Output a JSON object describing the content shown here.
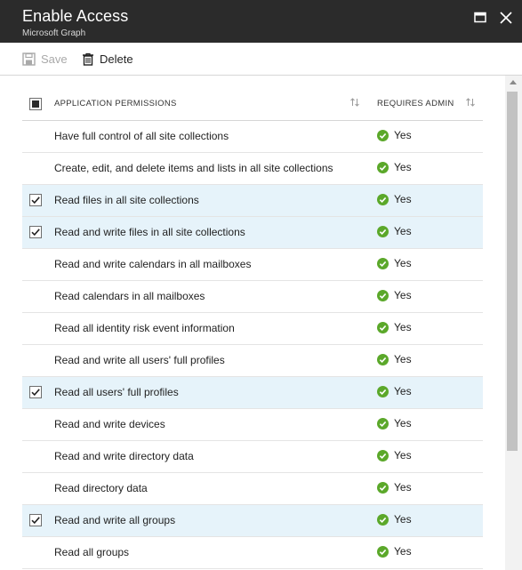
{
  "blade": {
    "title": "Enable Access",
    "subtitle": "Microsoft Graph"
  },
  "toolbar": {
    "save_label": "Save",
    "delete_label": "Delete"
  },
  "table": {
    "headers": {
      "permission": "APPLICATION PERMISSIONS",
      "requires_admin": "REQUIRES ADMIN"
    },
    "rows": [
      {
        "label": "Have full control of all site collections",
        "admin": "Yes",
        "checked": false
      },
      {
        "label": "Create, edit, and delete items and lists in all site collections",
        "admin": "Yes",
        "checked": false
      },
      {
        "label": "Read files in all site collections",
        "admin": "Yes",
        "checked": true
      },
      {
        "label": "Read and write files in all site collections",
        "admin": "Yes",
        "checked": true
      },
      {
        "label": "Read and write calendars in all mailboxes",
        "admin": "Yes",
        "checked": false
      },
      {
        "label": "Read calendars in all mailboxes",
        "admin": "Yes",
        "checked": false
      },
      {
        "label": "Read all identity risk event information",
        "admin": "Yes",
        "checked": false
      },
      {
        "label": "Read and write all users' full profiles",
        "admin": "Yes",
        "checked": false
      },
      {
        "label": "Read all users' full profiles",
        "admin": "Yes",
        "checked": true
      },
      {
        "label": "Read and write devices",
        "admin": "Yes",
        "checked": false
      },
      {
        "label": "Read and write directory data",
        "admin": "Yes",
        "checked": false
      },
      {
        "label": "Read directory data",
        "admin": "Yes",
        "checked": false
      },
      {
        "label": "Read and write all groups",
        "admin": "Yes",
        "checked": true
      },
      {
        "label": "Read all groups",
        "admin": "Yes",
        "checked": false
      }
    ]
  },
  "colors": {
    "titlebar_bg": "#2b2b2b",
    "selected_row_bg": "#e6f3fa",
    "check_green": "#5ba82a"
  }
}
